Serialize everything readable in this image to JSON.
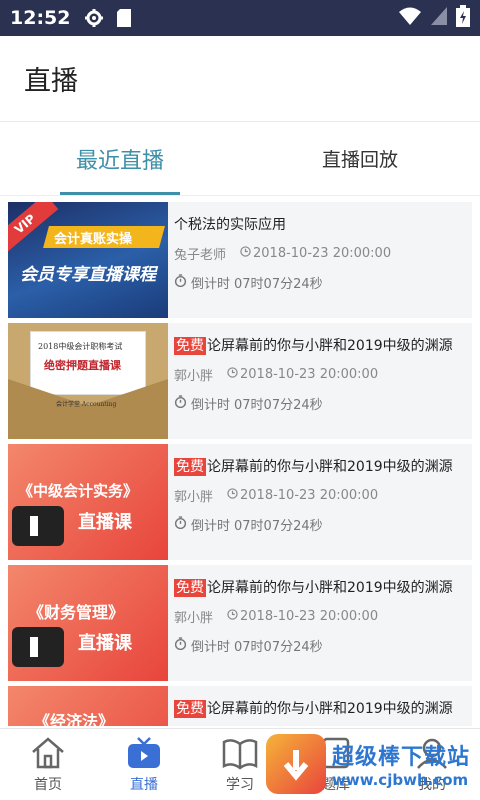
{
  "status": {
    "time": "12:52"
  },
  "header": {
    "title": "直播"
  },
  "tabs": [
    {
      "label": "最近直播",
      "active": true
    },
    {
      "label": "直播回放",
      "active": false
    }
  ],
  "items": [
    {
      "free": "",
      "title": "个税法的实际应用",
      "teacher": "兔子老师",
      "datetime": "2018-10-23 20:00:00",
      "countdown_label": "倒计时",
      "countdown": "07时07分24秒",
      "thumb": {
        "badge": "VIP",
        "line1": "会计真账实操",
        "line2": "会员专享直播课程"
      }
    },
    {
      "free": "免费",
      "title": "论屏幕前的你与小胖和2019中级的渊源",
      "teacher": "郭小胖",
      "datetime": "2018-10-23 20:00:00",
      "countdown_label": "倒计时",
      "countdown": "07时07分24秒",
      "thumb": {
        "line1": "2018中级会计职称考试",
        "line2": "绝密押题直播课",
        "line3": "会计学堂 Accounting"
      }
    },
    {
      "free": "免费",
      "title": "论屏幕前的你与小胖和2019中级的渊源",
      "teacher": "郭小胖",
      "datetime": "2018-10-23 20:00:00",
      "countdown_label": "倒计时",
      "countdown": "07时07分24秒",
      "thumb": {
        "line1": "《中级会计实务》",
        "line2": "直播课"
      }
    },
    {
      "free": "免费",
      "title": "论屏幕前的你与小胖和2019中级的渊源",
      "teacher": "郭小胖",
      "datetime": "2018-10-23 20:00:00",
      "countdown_label": "倒计时",
      "countdown": "07时07分24秒",
      "thumb": {
        "line1": "《财务管理》",
        "line2": "直播课"
      }
    },
    {
      "free": "免费",
      "title": "论屏幕前的你与小胖和2019中级的渊源",
      "teacher": "",
      "datetime": "",
      "countdown_label": "",
      "countdown": "",
      "thumb": {
        "line1": "《经济法》",
        "line2": ""
      }
    }
  ],
  "nav": [
    {
      "label": "首页",
      "icon": "home-icon"
    },
    {
      "label": "直播",
      "icon": "tv-icon",
      "active": true
    },
    {
      "label": "学习",
      "icon": "book-icon"
    },
    {
      "label": "题库",
      "icon": "question-icon"
    },
    {
      "label": "我的",
      "icon": "user-icon"
    }
  ],
  "watermark": {
    "title": "超级棒下载站",
    "url": "www.cjbwh.com"
  }
}
